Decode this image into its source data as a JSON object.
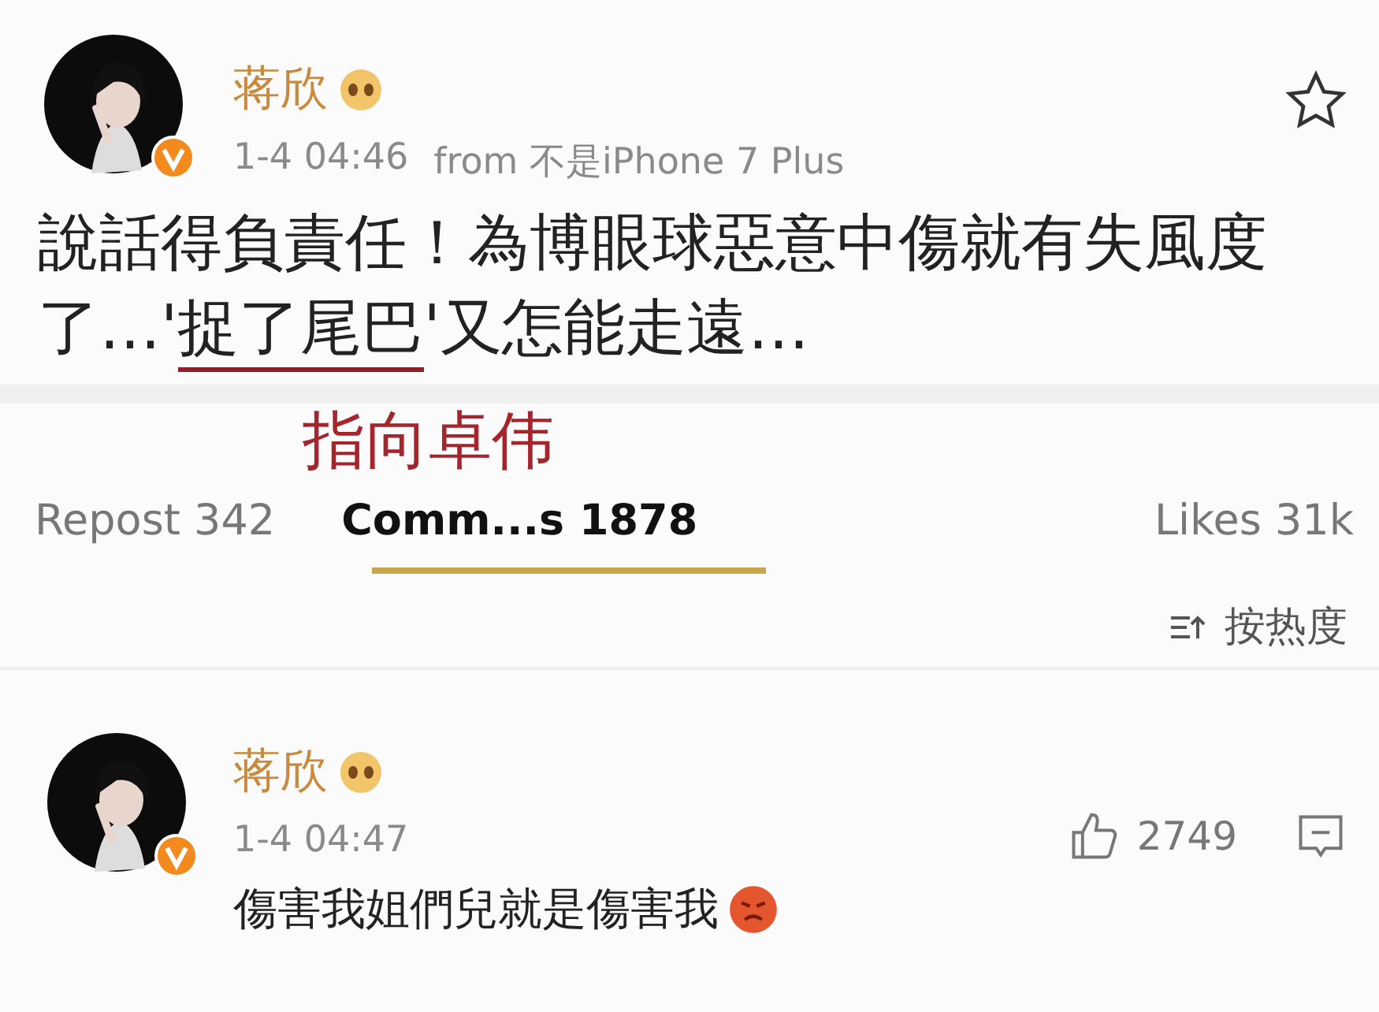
{
  "post": {
    "author": "蒋欣",
    "time": "1-4 04:46",
    "source": "from 不是iPhone 7 Plus",
    "text_before": "說話得負責任！為博眼球惡意中傷就有失風度了…'",
    "text_marked": "捉了尾巴",
    "text_after": "'又怎能走遠…",
    "favorited": false
  },
  "annotation": "指向卓伟",
  "tabs": [
    {
      "label": "Repost 342",
      "selected": false
    },
    {
      "label": "Comm...s 1878",
      "selected": true
    },
    {
      "label": "Likes 31k",
      "selected": false
    }
  ],
  "sort": {
    "label": "按热度"
  },
  "comment": {
    "author": "蒋欣",
    "time": "1-4 04:47",
    "likes": "2749",
    "text": "傷害我姐們兒就是傷害我"
  }
}
